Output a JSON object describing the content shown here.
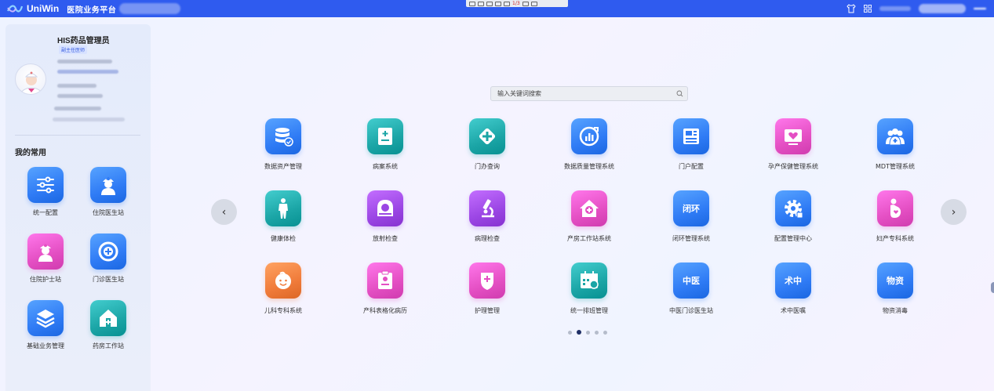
{
  "topbar": {
    "logo_text": "UniWin",
    "system_name": "医院业务平台",
    "toolbar_label": "1/3",
    "bg_color": "#2f5bef"
  },
  "sidebar": {
    "user_name": "HIS药品管理员",
    "user_title": "副主任医师",
    "favorites_title": "我的常用",
    "favorites": [
      {
        "label": "统一配置",
        "icon": "sliders-icon",
        "color": "#2f7bf5"
      },
      {
        "label": "住院医生站",
        "icon": "doctor-icon",
        "color": "#2f7bf5"
      },
      {
        "label": "住院护士站",
        "icon": "nurse-icon",
        "color": "#e44fc3"
      },
      {
        "label": "门诊医生站",
        "icon": "outpatient-icon",
        "color": "#2f7bf5"
      },
      {
        "label": "基础业务管理",
        "icon": "layers-icon",
        "color": "#2f7bf5"
      },
      {
        "label": "药房工作站",
        "icon": "pharmacy-icon",
        "color": "#1ba5a6"
      }
    ]
  },
  "search": {
    "placeholder": "输入关键词搜索"
  },
  "apps": [
    {
      "label": "数据资产管理",
      "icon": "database-icon",
      "color": "#2f7bf5"
    },
    {
      "label": "病案系统",
      "icon": "medical-record-icon",
      "color": "#1ba5a6"
    },
    {
      "label": "门办查询",
      "icon": "cross-diamond-icon",
      "color": "#1ba5a6"
    },
    {
      "label": "数据质量管理系统",
      "icon": "chart-icon",
      "color": "#2f7bf5"
    },
    {
      "label": "门户配置",
      "icon": "portal-icon",
      "color": "#2f7bf5"
    },
    {
      "label": "孕产保健管理系统",
      "icon": "maternal-icon",
      "color": "#e44fc3"
    },
    {
      "label": "MDT管理系统",
      "icon": "team-icon",
      "color": "#2f7bf5"
    },
    {
      "label": "健康体检",
      "icon": "body-icon",
      "color": "#1ba5a6"
    },
    {
      "label": "放射检查",
      "icon": "scanner-icon",
      "color": "#9b46e4"
    },
    {
      "label": "病理检查",
      "icon": "microscope-icon",
      "color": "#9b46e4"
    },
    {
      "label": "产房工作站系统",
      "icon": "house-cross-icon",
      "color": "#e44fc3"
    },
    {
      "label": "闭环管理系统",
      "icon": "text-tile-icon",
      "text": "闭环",
      "color": "#2f7bf5"
    },
    {
      "label": "配置管理中心",
      "icon": "gear-icon",
      "color": "#2f7bf5"
    },
    {
      "label": "妇产专科系统",
      "icon": "pregnant-icon",
      "color": "#e44fc3"
    },
    {
      "label": "儿科专科系统",
      "icon": "baby-icon",
      "color": "#f07b3a"
    },
    {
      "label": "产科表格化病历",
      "icon": "clipboard-icon",
      "color": "#e44fc3"
    },
    {
      "label": "护理管理",
      "icon": "hand-care-icon",
      "color": "#e44fc3"
    },
    {
      "label": "统一排班管理",
      "icon": "calendar-icon",
      "color": "#1ba5a6"
    },
    {
      "label": "中医门诊医生站",
      "icon": "text-tile-icon",
      "text": "中医",
      "color": "#2f7bf5"
    },
    {
      "label": "术中医嘱",
      "icon": "text-tile-icon",
      "text": "术中",
      "color": "#2f7bf5"
    },
    {
      "label": "物资消毒",
      "icon": "text-tile-icon",
      "text": "物资",
      "color": "#2f7bf5"
    }
  ],
  "pagination": {
    "nav_prev": "‹",
    "nav_next": "›",
    "pages": 5,
    "active": 2
  }
}
